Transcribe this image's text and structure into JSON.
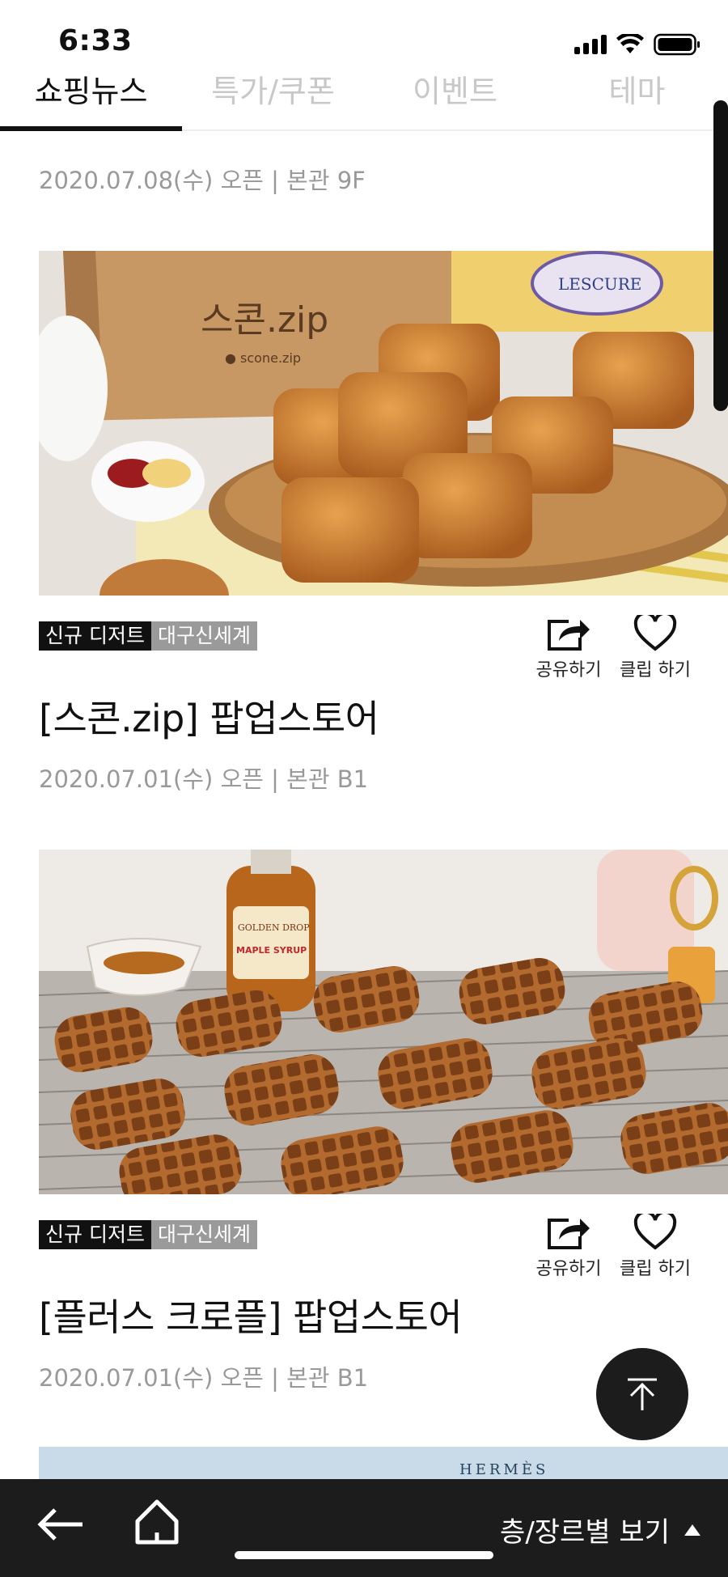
{
  "status_bar": {
    "time": "6:33"
  },
  "tabs": [
    {
      "label": "쇼핑뉴스",
      "active": true
    },
    {
      "label": "특가/쿠폰",
      "active": false
    },
    {
      "label": "이벤트",
      "active": false
    },
    {
      "label": "테마",
      "active": false
    }
  ],
  "prev_card": {
    "meta": "2020.07.08(수) 오픈 | 본관 9F"
  },
  "cards": [
    {
      "tags": [
        "신규 디저트",
        "대구신세계"
      ],
      "title": "[스콘.zip] 팝업스토어",
      "meta": "2020.07.01(수) 오픈 | 본관 B1",
      "image_box_text": "스콘.zip",
      "image_box_subtext": "● scone.zip",
      "image_butter_text": "LESCURE"
    },
    {
      "tags": [
        "신규 디저트",
        "대구신세계"
      ],
      "title": "[플러스 크로플] 팝업스토어",
      "meta": "2020.07.01(수) 오픈 | 본관 B1",
      "image_bottle_text": "GOLDEN DROP",
      "image_bottle_label": "MAPLE SYRUP"
    }
  ],
  "next_card": {
    "image_text": "HERMÈS"
  },
  "actions": {
    "share_label": "공유하기",
    "clip_label": "클립 하기"
  },
  "bottom_bar": {
    "floor_view_label": "층/장르별 보기"
  },
  "colors": {
    "accent": "#111111",
    "tag_gray": "#9a9a9a",
    "meta": "#999999",
    "bottom_bar": "#1c1c1c"
  }
}
